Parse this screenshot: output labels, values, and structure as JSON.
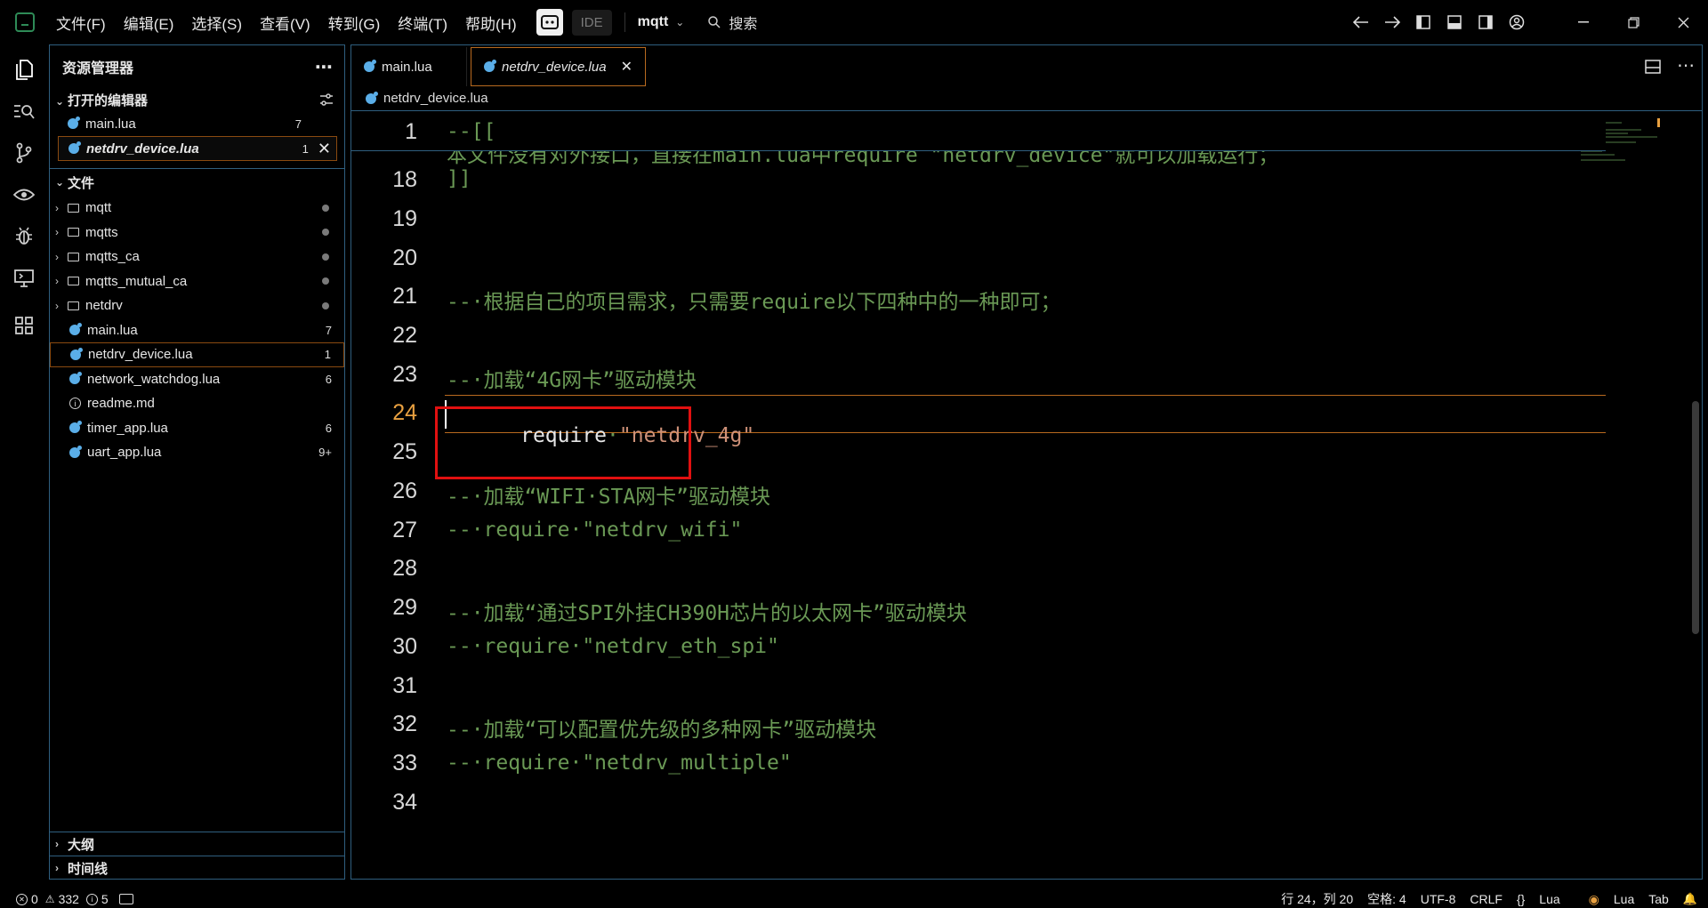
{
  "menu": {
    "items": [
      "文件(F)",
      "编辑(E)",
      "选择(S)",
      "查看(V)",
      "转到(G)",
      "终端(T)",
      "帮助(H)"
    ],
    "ide_label": "IDE",
    "project_name": "mqtt",
    "search_label": "搜索"
  },
  "sidebar": {
    "title": "资源管理器",
    "open_editors": {
      "title": "打开的编辑器",
      "items": [
        {
          "name": "main.lua",
          "badge": "7"
        },
        {
          "name": "netdrv_device.lua",
          "badge": "1"
        }
      ]
    },
    "files": {
      "title": "文件",
      "items": [
        {
          "name": "mqtt",
          "type": "folder"
        },
        {
          "name": "mqtts",
          "type": "folder"
        },
        {
          "name": "mqtts_ca",
          "type": "folder"
        },
        {
          "name": "mqtts_mutual_ca",
          "type": "folder"
        },
        {
          "name": "netdrv",
          "type": "folder"
        },
        {
          "name": "main.lua",
          "type": "lua",
          "badge": "7"
        },
        {
          "name": "netdrv_device.lua",
          "type": "lua",
          "badge": "1"
        },
        {
          "name": "network_watchdog.lua",
          "type": "lua",
          "badge": "6"
        },
        {
          "name": "readme.md",
          "type": "info"
        },
        {
          "name": "timer_app.lua",
          "type": "lua",
          "badge": "6"
        },
        {
          "name": "uart_app.lua",
          "type": "lua",
          "badge": "9+"
        }
      ]
    },
    "outline_title": "大纲",
    "timeline_title": "时间线"
  },
  "editor": {
    "tabs": [
      {
        "label": "main.lua",
        "active": false
      },
      {
        "label": "netdrv_device.lua",
        "active": true
      }
    ],
    "breadcrumb": "netdrv_device.lua",
    "sticky": {
      "num": "1",
      "text": "--[["
    },
    "partial_line": "本文件没有对外接口，直接在main.lua中require \"netdrv_device\"就可以加载运行；",
    "lines": [
      {
        "num": "18",
        "text": "]]",
        "kind": "cm"
      },
      {
        "num": "19",
        "text": "",
        "kind": "cm"
      },
      {
        "num": "20",
        "text": "",
        "kind": "cm"
      },
      {
        "num": "21",
        "text": "--·根据自己的项目需求，只需要require以下四种中的一种即可；",
        "kind": "cm"
      },
      {
        "num": "22",
        "text": "",
        "kind": "cm"
      },
      {
        "num": "23",
        "text": "--·加载“4G网卡”驱动模块",
        "kind": "cm"
      },
      {
        "num": "24",
        "kw": "require",
        "str": "\"netdrv_4g\"",
        "kind": "code"
      },
      {
        "num": "25",
        "text": "",
        "kind": "cm"
      },
      {
        "num": "26",
        "text": "--·加载“WIFI·STA网卡”驱动模块",
        "kind": "cm"
      },
      {
        "num": "27",
        "text": "--·require·\"netdrv_wifi\"",
        "kind": "cm"
      },
      {
        "num": "28",
        "text": "",
        "kind": "cm"
      },
      {
        "num": "29",
        "text": "--·加载“通过SPI外挂CH390H芯片的以太网卡”驱动模块",
        "kind": "cm"
      },
      {
        "num": "30",
        "text": "--·require·\"netdrv_eth_spi\"",
        "kind": "cm"
      },
      {
        "num": "31",
        "text": "",
        "kind": "cm"
      },
      {
        "num": "32",
        "text": "--·加载“可以配置优先级的多种网卡”驱动模块",
        "kind": "cm"
      },
      {
        "num": "33",
        "text": "--·require·\"netdrv_multiple\"",
        "kind": "cm"
      },
      {
        "num": "34",
        "text": "",
        "kind": "cm"
      }
    ]
  },
  "status": {
    "errors": "0",
    "warnings": "332",
    "infos": "5",
    "position": "行 24，列 20",
    "spaces": "空格: 4",
    "encoding": "UTF-8",
    "eol": "CRLF",
    "braces": "{}",
    "language": "Lua",
    "lua_ext": "Lua",
    "tab": "Tab"
  }
}
